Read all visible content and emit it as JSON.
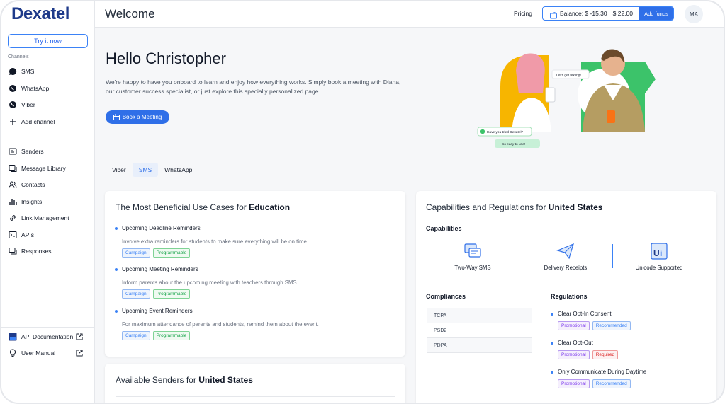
{
  "brand": {
    "logo_text": "Dexatel"
  },
  "sidebar": {
    "try_button": "Try it now",
    "channels_label": "Channels",
    "channels": [
      {
        "label": "SMS",
        "icon": "sms-icon"
      },
      {
        "label": "WhatsApp",
        "icon": "whatsapp-icon"
      },
      {
        "label": "Viber",
        "icon": "viber-icon"
      },
      {
        "label": "Add channel",
        "icon": "plus-icon"
      }
    ],
    "items": [
      {
        "label": "Senders",
        "icon": "senders-icon"
      },
      {
        "label": "Message Library",
        "icon": "message-library-icon"
      },
      {
        "label": "Contacts",
        "icon": "contacts-icon"
      },
      {
        "label": "Insights",
        "icon": "insights-icon"
      },
      {
        "label": "Link Management",
        "icon": "link-icon"
      },
      {
        "label": "APIs",
        "icon": "api-icon"
      },
      {
        "label": "Responses",
        "icon": "responses-icon"
      }
    ],
    "footer": [
      {
        "label": "API Documentation",
        "icon": "api-docs-icon"
      },
      {
        "label": "User Manual",
        "icon": "lightbulb-icon"
      }
    ]
  },
  "header": {
    "title": "Welcome",
    "pricing": "Pricing",
    "balance_label": "Balance: $ -15.30",
    "balance_secondary": "$ 22.00",
    "add_funds": "Add funds",
    "avatar_initials": "MA"
  },
  "hero": {
    "greeting": "Hello",
    "name": "Christopher",
    "intro": "We're happy to have you onboard to learn and enjoy how everything works. Simply book a meeting with Diana, our customer success specialist, or just explore this specially personalized page.",
    "book_button": "Book a Meeting",
    "bubble_1": "Let's get texting!",
    "bubble_2": "Have you tried Dexatel?",
    "bubble_3": "So easy to use!"
  },
  "tabs": [
    {
      "label": "Viber",
      "active": false
    },
    {
      "label": "SMS",
      "active": true
    },
    {
      "label": "WhatsApp",
      "active": false
    }
  ],
  "use_cases": {
    "title_prefix": "The Most Beneficial Use Cases for",
    "title_bold": "Education",
    "items": [
      {
        "title": "Upcoming Deadline Reminders",
        "desc": "Involve extra reminders for students to make sure everything will be on time.",
        "tags": [
          "Campaign",
          "Programmable"
        ]
      },
      {
        "title": "Upcoming Meeting Reminders",
        "desc": "Inform parents about the upcoming meeting with teachers through SMS.",
        "tags": [
          "Campaign",
          "Programmable"
        ]
      },
      {
        "title": "Upcoming Event Reminders",
        "desc": "For maximum attendance of parents and students, remind them about the event.",
        "tags": [
          "Campaign",
          "Programmable"
        ]
      }
    ]
  },
  "senders": {
    "title_prefix": "Available Senders for",
    "title_bold": "United States"
  },
  "capabilities": {
    "title_prefix": "Capabilities and Regulations for",
    "title_bold": "United States",
    "capabilities_label": "Capabilities",
    "items": [
      {
        "label": "Two-Way SMS",
        "icon": "two-way-sms-icon"
      },
      {
        "label": "Delivery Receipts",
        "icon": "delivery-receipts-icon"
      },
      {
        "label": "Unicode Supported",
        "icon": "unicode-icon"
      }
    ],
    "compliances_label": "Compliances",
    "compliances": [
      "TCPA",
      "PSD2",
      "PDPA"
    ],
    "regulations_label": "Regulations",
    "regulations": [
      {
        "title": "Clear Opt-In Consent",
        "tags": [
          "Promotional",
          "Recommended"
        ]
      },
      {
        "title": "Clear Opt-Out",
        "tags": [
          "Promotional",
          "Required"
        ]
      },
      {
        "title": "Only Communicate During Daytime",
        "tags": [
          "Promotional",
          "Recommended"
        ]
      }
    ]
  },
  "colors": {
    "accent": "#2f6fe8",
    "brand": "#1e3a8a",
    "hero_yellow": "#f7b500",
    "hero_green": "#3cc36a"
  }
}
